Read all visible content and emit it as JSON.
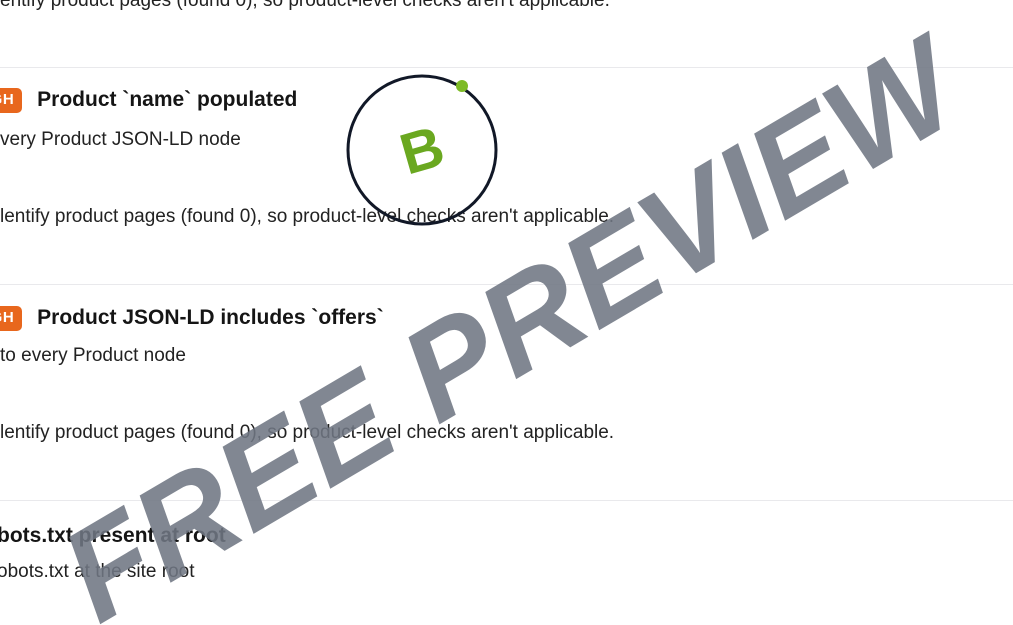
{
  "checks": [
    {
      "result": "entify product pages (found 0), so product-level checks aren't applicable."
    },
    {
      "severity": "IGH",
      "title": "Product `name` populated",
      "description": "very Product JSON-LD node",
      "result": "lentify product pages (found 0), so product-level checks aren't applicable."
    },
    {
      "severity": "IGH",
      "title": "Product JSON-LD includes `offers`",
      "description": "to every Product node",
      "result": "lentify product pages (found 0), so product-level checks aren't applicable."
    },
    {
      "title": "bots.txt present at root",
      "description": "obots.txt at the site root"
    }
  ],
  "grade": {
    "letter": "B",
    "ring_color": "#111827",
    "letter_color": "#6aa820",
    "dot_color": "#7dbb25"
  },
  "watermark": {
    "text": "FREE PREVIEW"
  }
}
